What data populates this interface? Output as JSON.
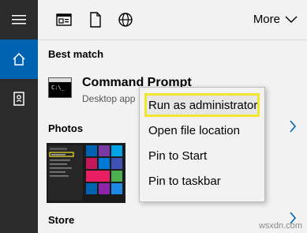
{
  "topbar": {
    "more_label": "More"
  },
  "sections": {
    "best_match": "Best match",
    "photos": "Photos",
    "store": "Store"
  },
  "result": {
    "title": "Command Prompt",
    "subtitle": "Desktop app"
  },
  "context_menu": {
    "items": [
      "Run as administrator",
      "Open file location",
      "Pin to Start",
      "Pin to taskbar"
    ]
  },
  "watermark": "wsxdn.com",
  "colors": {
    "accent": "#0063b1",
    "rail": "#2b2b2b",
    "highlight_outline": "#f1e62d"
  },
  "icons": {
    "rail": [
      "hamburger-icon",
      "home-icon",
      "notebook-icon"
    ],
    "topbar": [
      "apps-icon",
      "documents-icon",
      "web-icon",
      "chevron-down-icon"
    ]
  }
}
